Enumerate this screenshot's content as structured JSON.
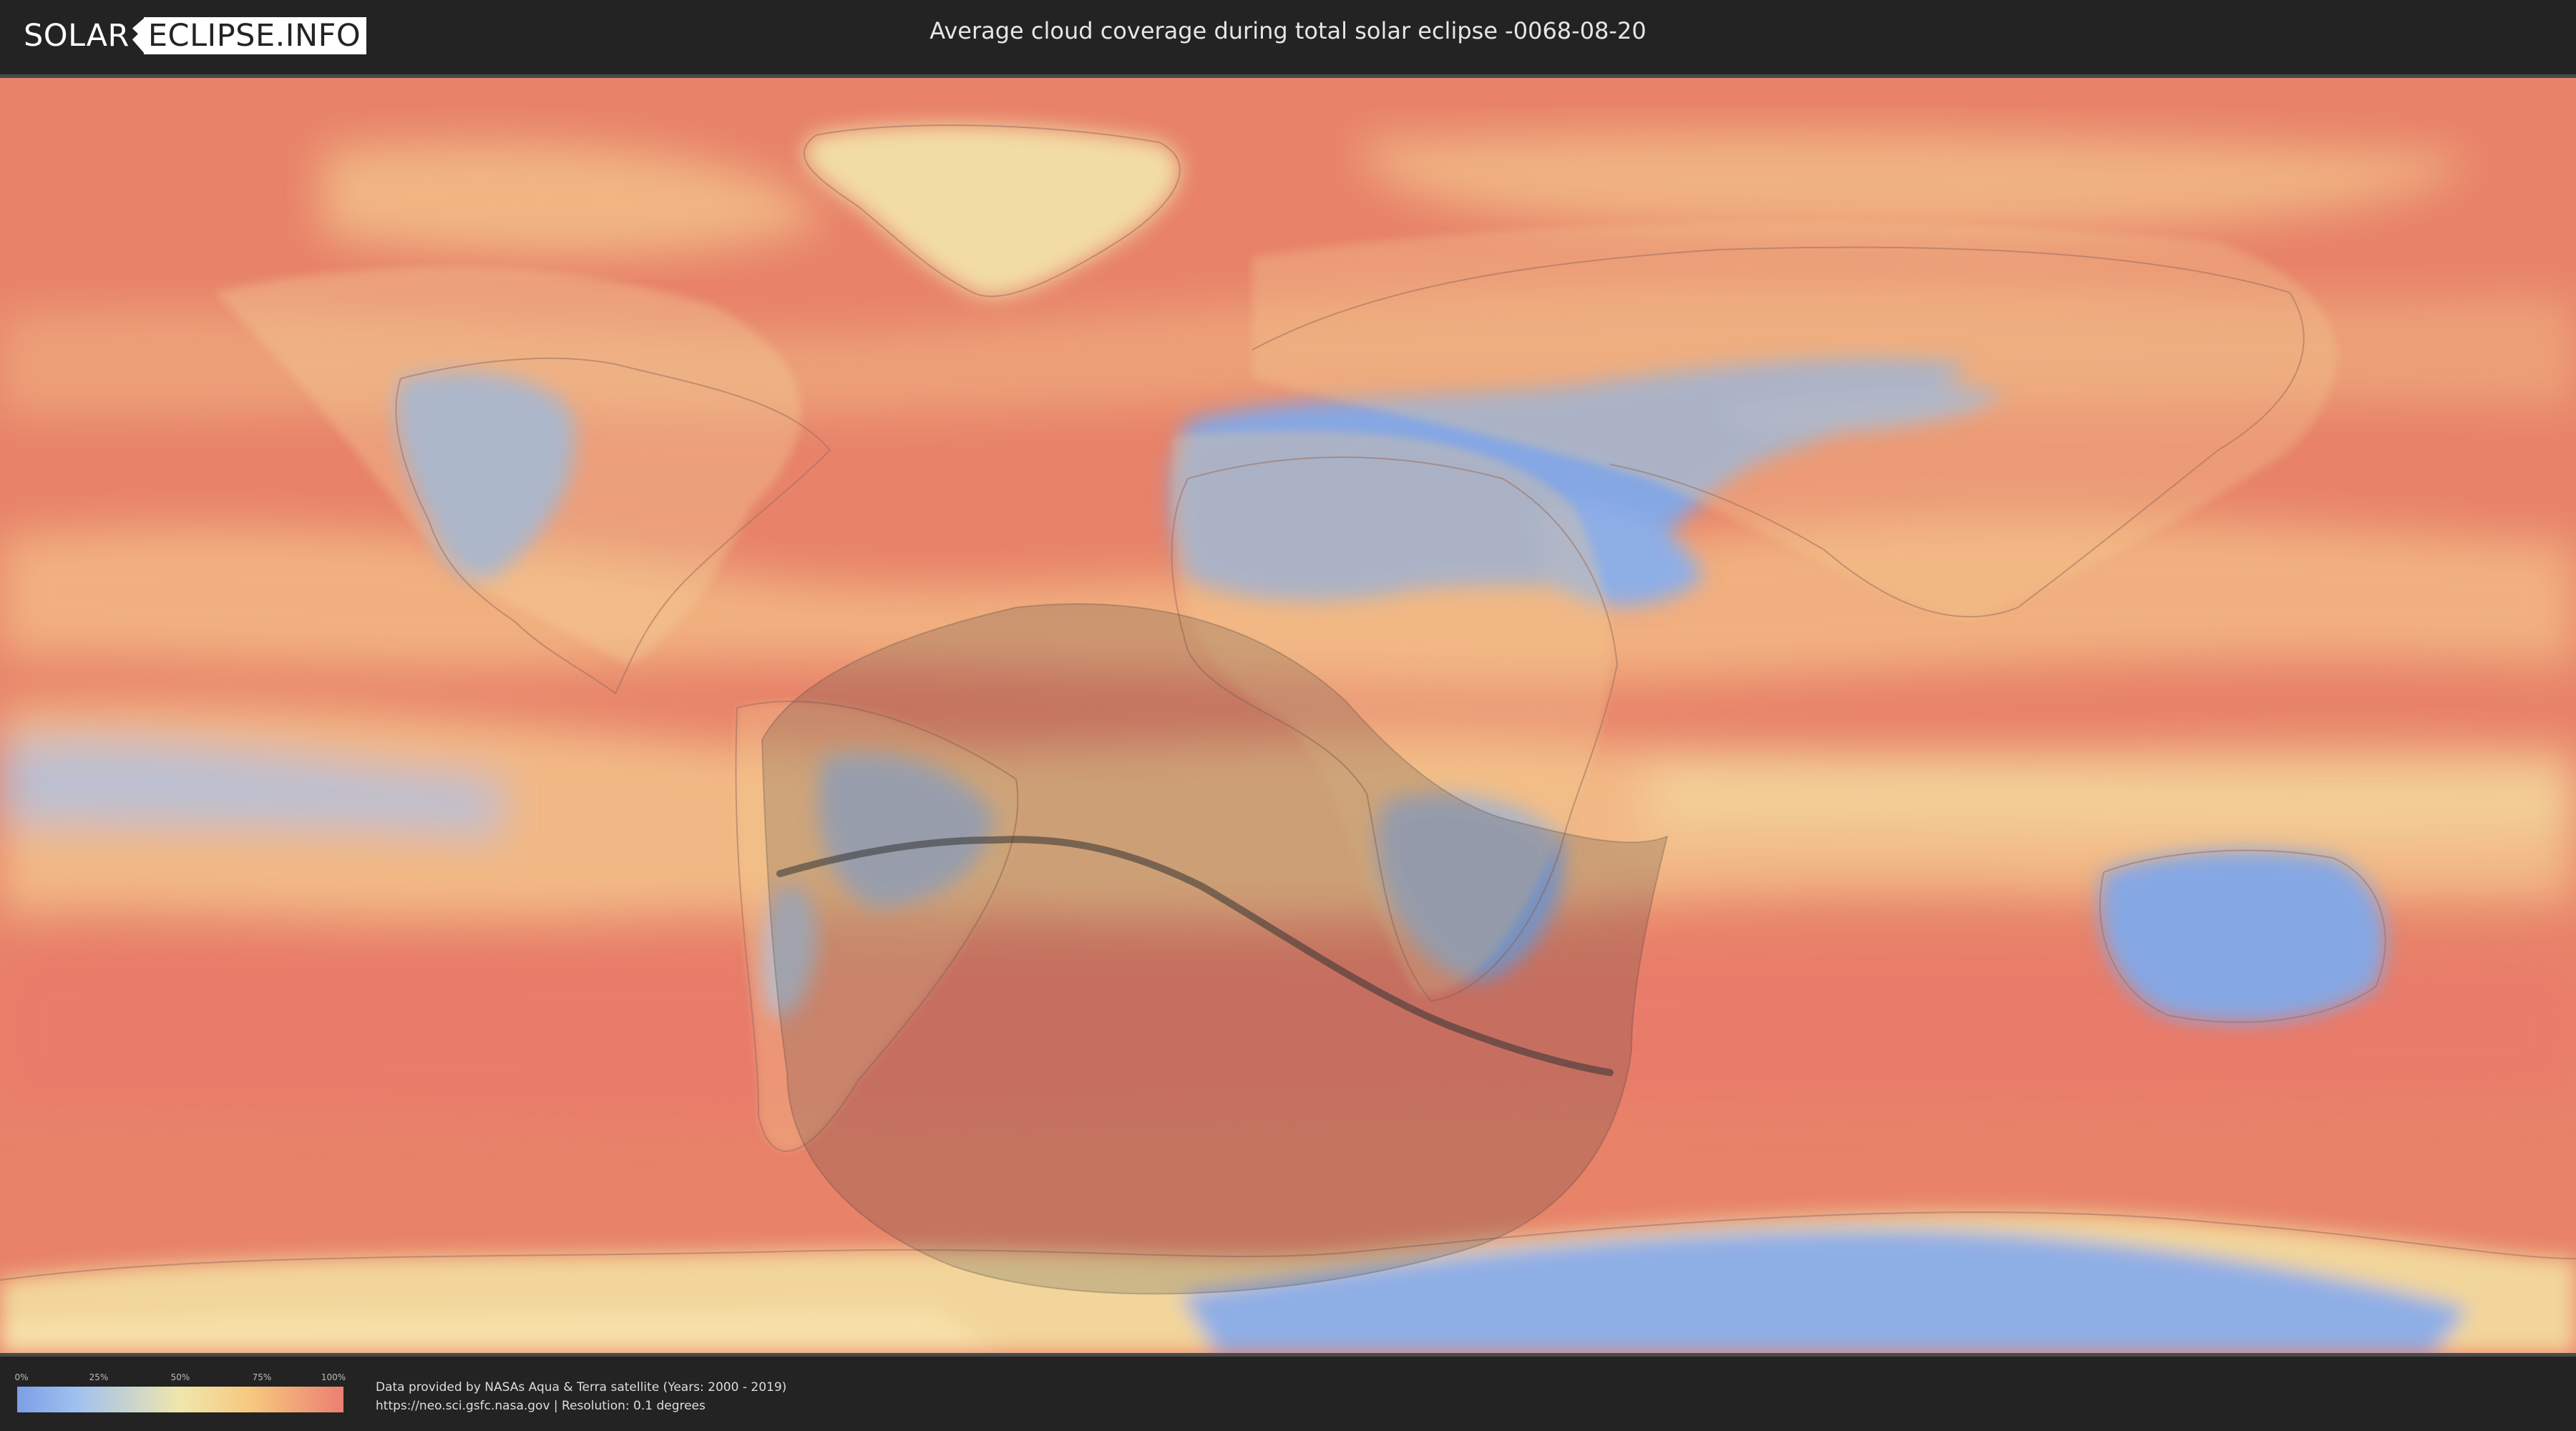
{
  "header": {
    "logo_left": "SOLAR",
    "logo_right": "ECLIPSE.INFO",
    "title": "Average cloud coverage during total solar eclipse -0068-08-20"
  },
  "map": {
    "layer": "average cloud coverage",
    "projection": "equirectangular",
    "overlays": [
      "penumbra-shadow-region",
      "eclipse-centerline"
    ],
    "colors": {
      "ocean_cloudy": "#e8836a",
      "mid_cloud": "#f3c28a",
      "low_cloud": "#f2e4a8",
      "clear": "#85a7e4",
      "shadow": "#3a3a3a"
    }
  },
  "legend": {
    "ticks": [
      "0%",
      "25%",
      "50%",
      "75%",
      "100%"
    ],
    "colors": [
      "#7c9fe6",
      "#f0e6ac",
      "#eb7f72"
    ]
  },
  "footer": {
    "credit_line1": "Data provided by NASAs Aqua & Terra satellite (Years: 2000 - 2019)",
    "credit_line2": "https://neo.sci.gsfc.nasa.gov | Resolution: 0.1 degrees"
  }
}
